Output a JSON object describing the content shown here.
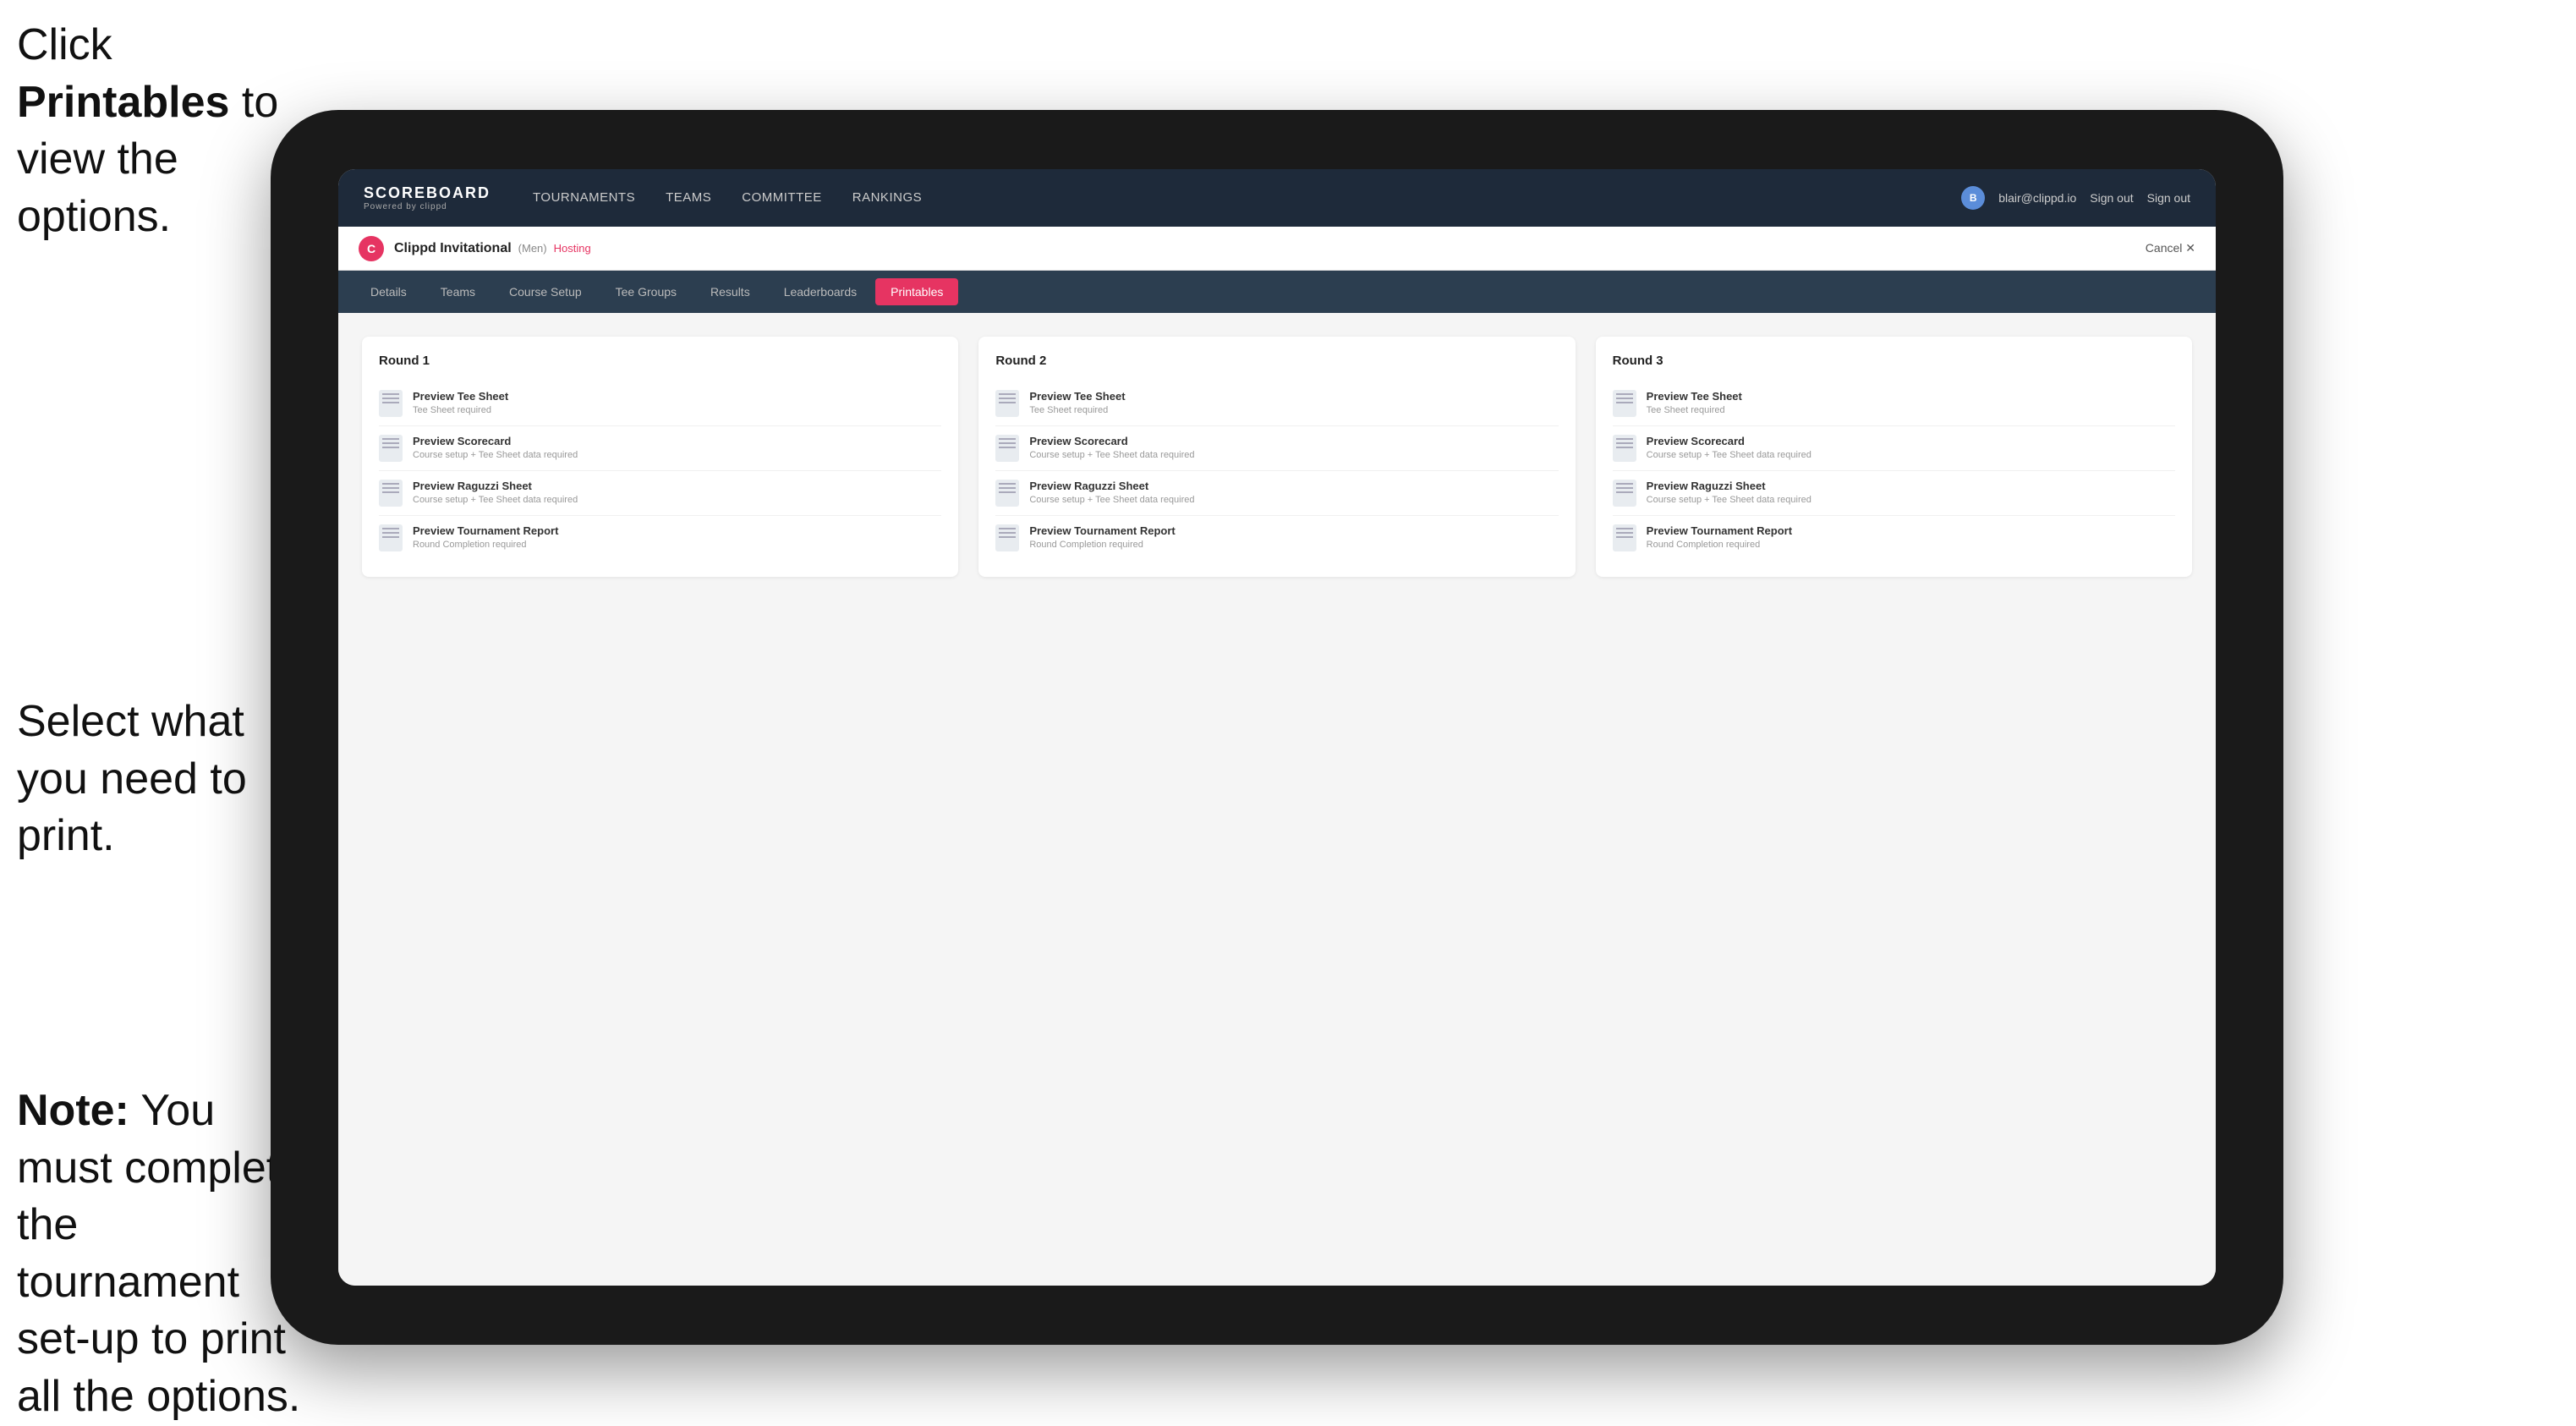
{
  "annotations": {
    "top": {
      "line1": "Click ",
      "bold": "Printables",
      "line2": " to",
      "line3": "view the options."
    },
    "middle": {
      "text": "Select what you need to print."
    },
    "bottom": {
      "bold": "Note:",
      "text": " You must complete the tournament set-up to print all the options."
    }
  },
  "nav": {
    "logo": "SCOREBOARD",
    "logo_sub": "Powered by clippd",
    "items": [
      {
        "label": "TOURNAMENTS",
        "active": false
      },
      {
        "label": "TEAMS",
        "active": false
      },
      {
        "label": "COMMITTEE",
        "active": false
      },
      {
        "label": "RANKINGS",
        "active": false
      }
    ],
    "user_email": "blair@clippd.io",
    "sign_out": "Sign out"
  },
  "tournament": {
    "logo_letter": "C",
    "name": "Clippd Invitational",
    "badge": "(Men)",
    "status": "Hosting",
    "cancel": "Cancel ✕"
  },
  "tabs": [
    {
      "label": "Details",
      "active": false
    },
    {
      "label": "Teams",
      "active": false
    },
    {
      "label": "Course Setup",
      "active": false
    },
    {
      "label": "Tee Groups",
      "active": false
    },
    {
      "label": "Results",
      "active": false
    },
    {
      "label": "Leaderboards",
      "active": false
    },
    {
      "label": "Printables",
      "active": true
    }
  ],
  "rounds": [
    {
      "title": "Round 1",
      "items": [
        {
          "title": "Preview Tee Sheet",
          "sub": "Tee Sheet required"
        },
        {
          "title": "Preview Scorecard",
          "sub": "Course setup + Tee Sheet data required"
        },
        {
          "title": "Preview Raguzzi Sheet",
          "sub": "Course setup + Tee Sheet data required"
        },
        {
          "title": "Preview Tournament Report",
          "sub": "Round Completion required"
        }
      ]
    },
    {
      "title": "Round 2",
      "items": [
        {
          "title": "Preview Tee Sheet",
          "sub": "Tee Sheet required"
        },
        {
          "title": "Preview Scorecard",
          "sub": "Course setup + Tee Sheet data required"
        },
        {
          "title": "Preview Raguzzi Sheet",
          "sub": "Course setup + Tee Sheet data required"
        },
        {
          "title": "Preview Tournament Report",
          "sub": "Round Completion required"
        }
      ]
    },
    {
      "title": "Round 3",
      "items": [
        {
          "title": "Preview Tee Sheet",
          "sub": "Tee Sheet required"
        },
        {
          "title": "Preview Scorecard",
          "sub": "Course setup + Tee Sheet data required"
        },
        {
          "title": "Preview Raguzzi Sheet",
          "sub": "Course setup + Tee Sheet data required"
        },
        {
          "title": "Preview Tournament Report",
          "sub": "Round Completion required"
        }
      ]
    }
  ]
}
